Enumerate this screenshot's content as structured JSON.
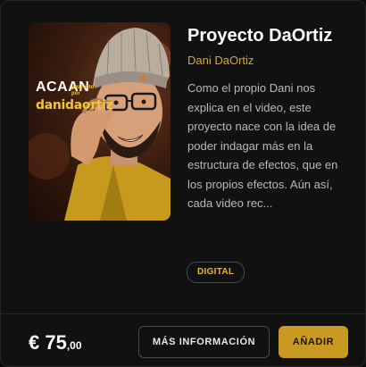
{
  "product": {
    "title": "Proyecto DaOrtiz",
    "author": "Dani DaOrtiz",
    "description": "Como el propio Dani nos explica en el video, este proyecto nace con la idea de poder indagar más en la estructura de efectos, que en los propios efectos. Aún así, cada video rec...",
    "badge": "DIGITAL",
    "cover": {
      "title": "ACAAN",
      "subtitle": "proyecto por",
      "brand": "danidaortiz"
    }
  },
  "price": {
    "main": "€ 75",
    "cents": ",00"
  },
  "actions": {
    "info_label": "MÁS INFORMACIÓN",
    "add_label": "AÑADIR"
  },
  "colors": {
    "accent": "#c99a22",
    "author": "#d4a72c",
    "background": "#111111"
  }
}
